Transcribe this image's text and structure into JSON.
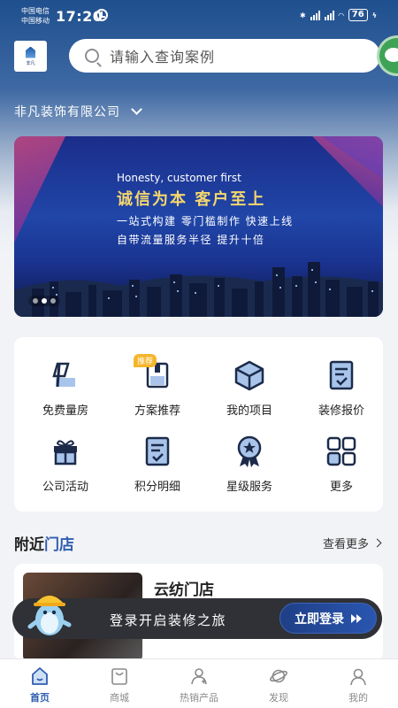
{
  "status_bar": {
    "carrier_1": "中国电信",
    "carrier_2": "中国移动",
    "time": "17:20",
    "battery": "76"
  },
  "header": {
    "logo_text": "非凡",
    "search_placeholder": "请输入查询案例",
    "company_name": "非凡装饰有限公司"
  },
  "banner": {
    "slogan_en": "Honesty, customer first",
    "slogan_cn": "诚信为本  客户至上",
    "line_1": "一站式构建  零门槛制作  快速上线",
    "line_2": "自带流量服务半径  提升十倍",
    "slide_count": 3,
    "active_slide": 2
  },
  "services": [
    {
      "label": "免费量房",
      "icon": "ruler-icon"
    },
    {
      "label": "方案推荐",
      "icon": "book-icon",
      "badge": "推荐"
    },
    {
      "label": "我的项目",
      "icon": "cube-icon"
    },
    {
      "label": "装修报价",
      "icon": "quote-doc-icon"
    },
    {
      "label": "公司活动",
      "icon": "gift-icon"
    },
    {
      "label": "积分明细",
      "icon": "points-doc-icon"
    },
    {
      "label": "星级服务",
      "icon": "star-medal-icon"
    },
    {
      "label": "更多",
      "icon": "more-grid-icon"
    }
  ],
  "nearby": {
    "title_prefix": "附近",
    "title_accent": "门店",
    "more_label": "查看更多",
    "store_name": "云纺门店"
  },
  "login_banner": {
    "text": "登录开启装修之旅",
    "button": "立即登录"
  },
  "tabbar": [
    {
      "label": "首页",
      "icon": "home-icon",
      "active": true
    },
    {
      "label": "商城",
      "icon": "mall-bag-icon",
      "active": false
    },
    {
      "label": "热销产品",
      "icon": "hot-product-icon",
      "active": false
    },
    {
      "label": "发现",
      "icon": "planet-icon",
      "active": false
    },
    {
      "label": "我的",
      "icon": "profile-icon",
      "active": false
    }
  ],
  "colors": {
    "accent": "#2f5db1",
    "header_top": "#1f4f8e",
    "banner_gold": "#f5d66e",
    "badge": "#f5b52b"
  }
}
